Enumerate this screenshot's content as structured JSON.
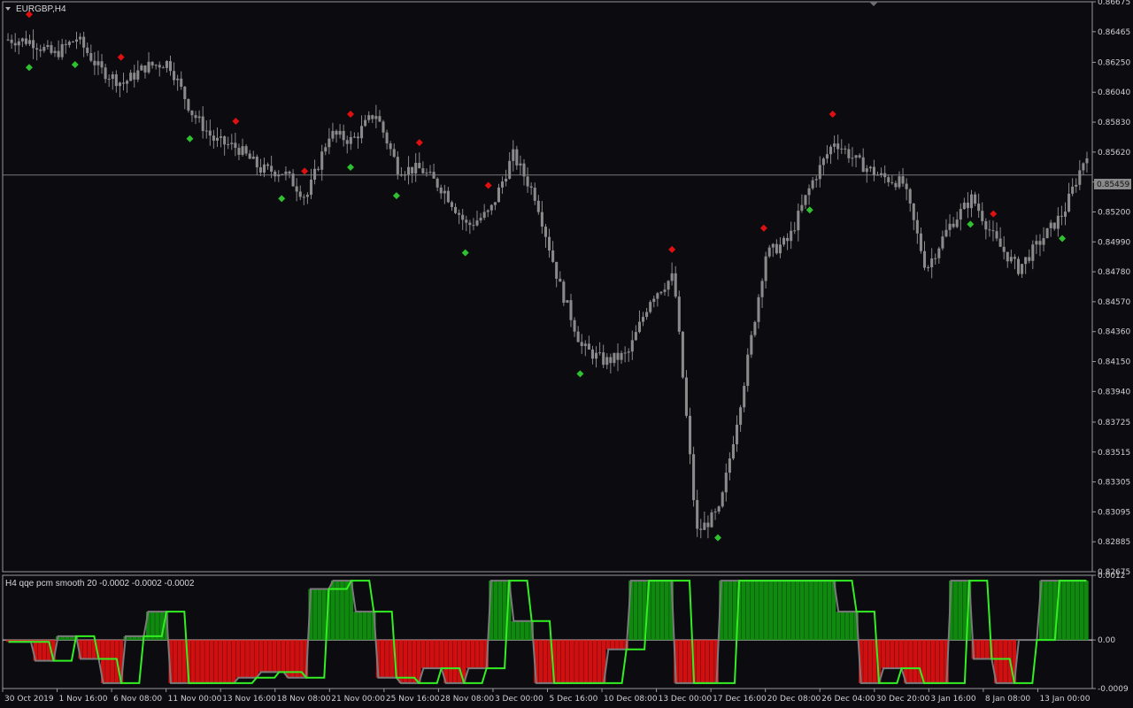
{
  "chart": {
    "symbol_label": "EURGBP,H4",
    "indicator_label": "H4  qqe pcm smooth  20 -0.0002 -0.0002 -0.0002",
    "current_price": "0.85459",
    "price_labels": [
      "0.86675",
      "0.86465",
      "0.86250",
      "0.86040",
      "0.85830",
      "0.85620",
      "0.85410",
      "0.85200",
      "0.84990",
      "0.84780",
      "0.84570",
      "0.84360",
      "0.84150",
      "0.83940",
      "0.83725",
      "0.83515",
      "0.83305",
      "0.83095",
      "0.82885",
      "0.82675"
    ],
    "indicator_labels": [
      "0.0012",
      "0.00",
      "-0.0009"
    ],
    "time_labels": [
      "30 Oct 2019",
      "1 Nov 16:00",
      "6 Nov 08:00",
      "11 Nov 00:00",
      "13 Nov 16:00",
      "18 Nov 08:00",
      "21 Nov 00:00",
      "25 Nov 16:00",
      "28 Nov 08:00",
      "3 Dec 00:00",
      "5 Dec 16:00",
      "10 Dec 08:00",
      "13 Dec 00:00",
      "17 Dec 16:00",
      "20 Dec 08:00",
      "26 Dec 04:00",
      "30 Dec 20:00",
      "3 Jan 16:00",
      "8 Jan 08:00",
      "13 Jan 00:00"
    ],
    "colors": {
      "background": "#0b0b10",
      "candle": "#8a8a8a",
      "buy_marker": "#2fc12f",
      "sell_marker": "#e01010",
      "hist_positive": "#0f8a0f",
      "hist_negative": "#d01010",
      "smooth_line": "#33ee22",
      "slow_line": "#7a7a7a",
      "price_line": "#7a7a7a"
    }
  },
  "chart_data": {
    "type": "line",
    "title": "EURGBP,H4",
    "ylim": [
      0.82675,
      0.86675
    ],
    "x": [
      "30 Oct",
      "1 Nov",
      "3 Nov",
      "5 Nov",
      "6 Nov",
      "8 Nov",
      "10 Nov",
      "11 Nov",
      "12 Nov",
      "13 Nov",
      "15 Nov",
      "17 Nov",
      "18 Nov",
      "19 Nov",
      "21 Nov",
      "22 Nov",
      "24 Nov",
      "25 Nov",
      "27 Nov",
      "28 Nov",
      "30 Nov",
      "2 Dec",
      "3 Dec",
      "4 Dec",
      "5 Dec",
      "6 Dec",
      "8 Dec",
      "10 Dec",
      "11 Dec",
      "12 Dec",
      "13 Dec",
      "14 Dec",
      "16 Dec",
      "17 Dec",
      "19 Dec",
      "20 Dec",
      "22 Dec",
      "24 Dec",
      "26 Dec",
      "28 Dec",
      "30 Dec",
      "1 Jan",
      "3 Jan",
      "5 Jan",
      "7 Jan",
      "8 Jan",
      "10 Jan",
      "13 Jan"
    ],
    "series": [
      {
        "values": [
          0.8641,
          0.864,
          0.863,
          0.8642,
          0.862,
          0.861,
          0.8622,
          0.8625,
          0.859,
          0.857,
          0.8565,
          0.855,
          0.8548,
          0.853,
          0.8575,
          0.857,
          0.859,
          0.855,
          0.855,
          0.8535,
          0.851,
          0.852,
          0.856,
          0.853,
          0.847,
          0.8425,
          0.8415,
          0.842,
          0.846,
          0.8475,
          0.8295,
          0.831,
          0.8395,
          0.849,
          0.85,
          0.854,
          0.857,
          0.8555,
          0.8545,
          0.854,
          0.848,
          0.851,
          0.853,
          0.85,
          0.848,
          0.85,
          0.852,
          0.8562
        ]
      }
    ],
    "indicator": {
      "name": "qqe pcm smooth",
      "params": [
        20,
        -0.0002,
        -0.0002,
        -0.0002
      ],
      "ylim": [
        -0.0009,
        0.0012
      ]
    },
    "markers": {
      "buy": [
        "1 Nov",
        "5 Nov",
        "12 Nov",
        "18 Nov",
        "22 Nov",
        "25 Nov",
        "30 Nov",
        "6 Dec",
        "14 Dec",
        "20 Dec",
        "3 Jan",
        "10 Jan"
      ],
      "sell": [
        "1 Nov",
        "8 Nov",
        "15 Nov",
        "19 Nov",
        "22 Nov",
        "27 Nov",
        "2 Dec",
        "12 Dec",
        "17 Dec",
        "22 Dec",
        "5 Jan"
      ]
    }
  }
}
